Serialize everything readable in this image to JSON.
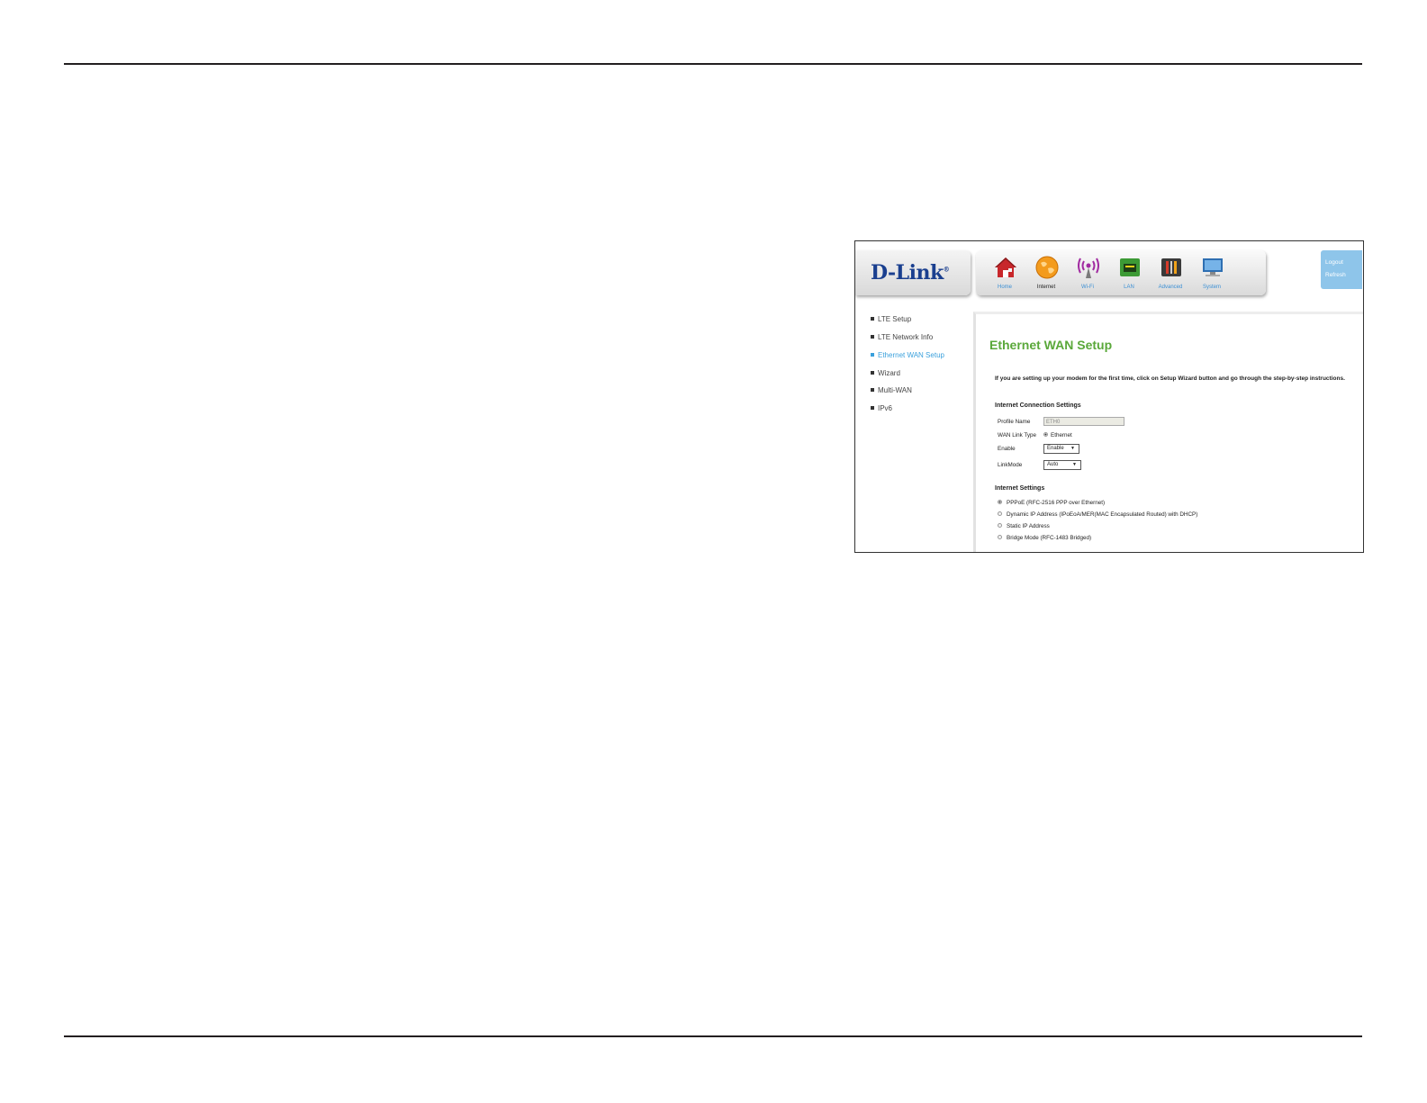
{
  "brand": {
    "logo": "D-Link"
  },
  "nav": {
    "items": [
      {
        "label": "Home",
        "icon": "home-icon"
      },
      {
        "label": "Internet",
        "icon": "globe-icon"
      },
      {
        "label": "Wi-Fi",
        "icon": "wifi-icon"
      },
      {
        "label": "LAN",
        "icon": "lan-port-icon"
      },
      {
        "label": "Advanced",
        "icon": "tools-icon"
      },
      {
        "label": "System",
        "icon": "monitor-icon"
      }
    ],
    "active": "Internet"
  },
  "account": {
    "logout": "Logout",
    "refresh": "Refresh"
  },
  "sidebar": {
    "items": [
      {
        "label": "LTE Setup"
      },
      {
        "label": "LTE Network Info"
      },
      {
        "label": "Ethernet WAN Setup"
      },
      {
        "label": "Wizard"
      },
      {
        "label": "Multi-WAN"
      },
      {
        "label": "IPv6"
      }
    ],
    "active": "Ethernet WAN Setup"
  },
  "main": {
    "title": "Ethernet WAN Setup",
    "intro": "If you are setting up your modem for the first time, click on Setup Wizard button and go through the step-by-step instructions.",
    "connection": {
      "heading": "Internet Connection Settings",
      "profile_name_label": "Profile Name",
      "profile_name_value": "ETH0",
      "wan_link_type_label": "WAN Link Type",
      "wan_link_type_value": "Ethernet",
      "enable_label": "Enable",
      "enable_value": "Enable",
      "linkmode_label": "LinkMode",
      "linkmode_value": "Auto"
    },
    "internet": {
      "heading": "Internet Settings",
      "options": [
        {
          "label": "PPPoE (RFC-2516 PPP over Ethernet)",
          "selected": true
        },
        {
          "label": "Dynamic IP Address (IPoEoA/MER(MAC Encapsulated Routed) with DHCP)",
          "selected": false
        },
        {
          "label": "Static IP Address",
          "selected": false
        },
        {
          "label": "Bridge Mode (RFC-1483 Bridged)",
          "selected": false
        }
      ]
    }
  },
  "colors": {
    "title_green": "#5aa83a",
    "link_blue": "#3aa0dc",
    "account_blue": "#8ec5ea",
    "logo_navy": "#1a3f8f"
  }
}
